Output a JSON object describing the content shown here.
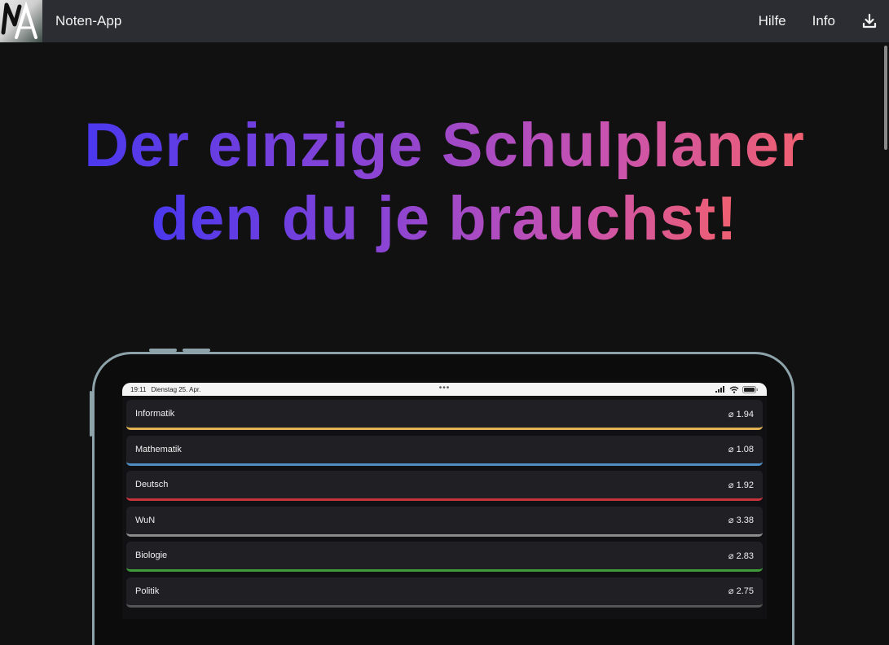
{
  "nav": {
    "brand": "Noten-App",
    "links": [
      "Hilfe",
      "Info"
    ],
    "download_icon": "download-icon"
  },
  "hero": {
    "line1": "Der einzige Schulplaner",
    "line2": "den du je brauchst!"
  },
  "device": {
    "time": "19:11",
    "date": "Dienstag 25. Apr.",
    "menu_dots": "•••",
    "subjects": [
      {
        "name": "Informatik",
        "average": "⌀ 1.94",
        "color": "#e2b254"
      },
      {
        "name": "Mathematik",
        "average": "⌀ 1.08",
        "color": "#4f8fc6"
      },
      {
        "name": "Deutsch",
        "average": "⌀ 1.92",
        "color": "#c7343c"
      },
      {
        "name": "WuN",
        "average": "⌀ 3.38",
        "color": "#8c8c8c"
      },
      {
        "name": "Biologie",
        "average": "⌀ 2.83",
        "color": "#3f9a3a"
      },
      {
        "name": "Politik",
        "average": "⌀ 2.75",
        "color": "#555555"
      }
    ]
  }
}
